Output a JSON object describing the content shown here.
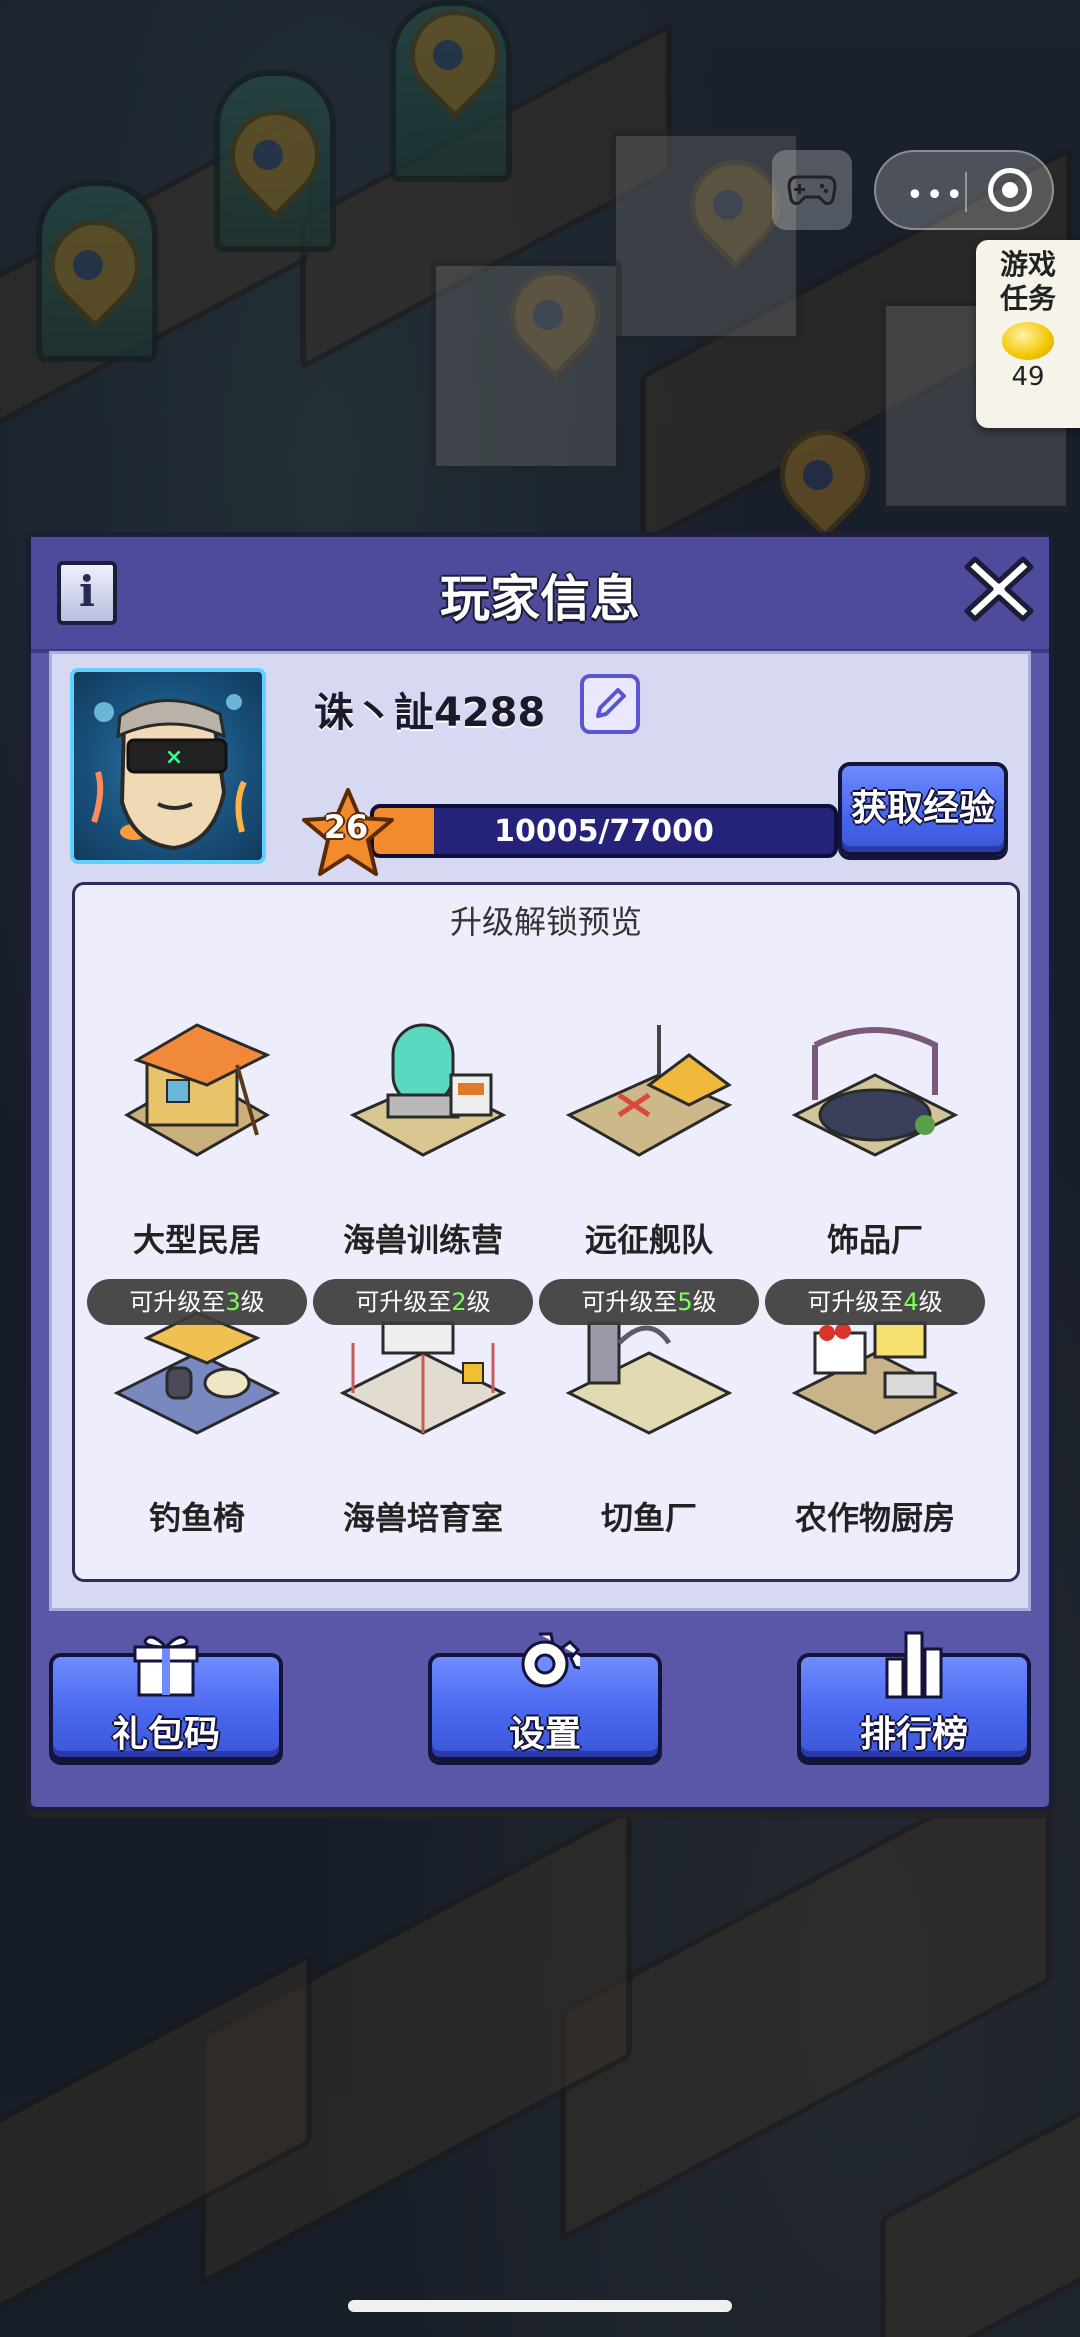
{
  "panel": {
    "title": "玩家信息"
  },
  "player": {
    "name": "诛丶訨4288",
    "level": "26",
    "exp_text": "10005/77000",
    "exp_fraction": 0.13,
    "get_exp_label": "获取经验"
  },
  "unlock": {
    "title": "升级解锁预览",
    "buildings": [
      {
        "label": "大型民居",
        "badge_prefix": "",
        "badge_level": "",
        "badge_suffix": ""
      },
      {
        "label": "海兽训练营",
        "badge_prefix": "",
        "badge_level": "",
        "badge_suffix": ""
      },
      {
        "label": "远征舰队",
        "badge_prefix": "",
        "badge_level": "",
        "badge_suffix": ""
      },
      {
        "label": "饰品厂",
        "badge_prefix": "",
        "badge_level": "",
        "badge_suffix": ""
      },
      {
        "label": "钓鱼椅",
        "badge_prefix": "可升级至",
        "badge_level": "3",
        "badge_suffix": "级"
      },
      {
        "label": "海兽培育室",
        "badge_prefix": "可升级至",
        "badge_level": "2",
        "badge_suffix": "级"
      },
      {
        "label": "切鱼厂",
        "badge_prefix": "可升级至",
        "badge_level": "5",
        "badge_suffix": "级"
      },
      {
        "label": "农作物厨房",
        "badge_prefix": "可升级至",
        "badge_level": "4",
        "badge_suffix": "级"
      }
    ]
  },
  "bottom_buttons": {
    "gift_code": "礼包码",
    "settings": "设置",
    "leaderboard": "排行榜"
  },
  "hud": {
    "task_label_1": "游戏",
    "task_label_2": "任务",
    "task_count": "49",
    "capsule_dots": "•••"
  },
  "colors": {
    "panel_bg": "#5a56a8",
    "exp_fill": "#f28a2e",
    "level_badge_green": "#7dff55",
    "button_blue": "#4a68ee"
  }
}
